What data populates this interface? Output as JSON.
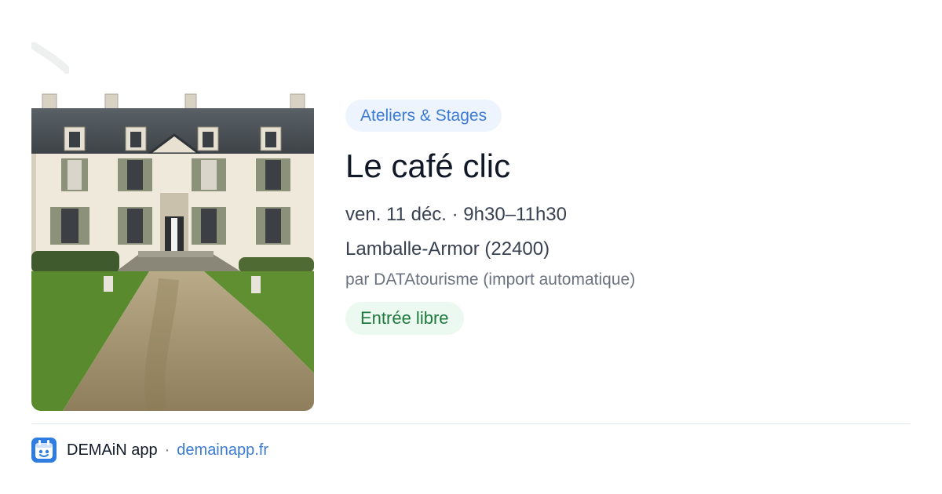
{
  "event": {
    "category": "Ateliers & Stages",
    "title": "Le café clic",
    "date_time": "ven. 11 déc. · 9h30–11h30",
    "location": "Lamballe-Armor (22400)",
    "source": "par DATAtourisme (import automatique)",
    "price": "Entrée libre"
  },
  "footer": {
    "app_name": "DEMAiN app",
    "separator": "·",
    "domain": "demainapp.fr"
  },
  "colors": {
    "category_text": "#3b7bd4",
    "category_bg": "#eef4fe",
    "price_text": "#1e7a3c",
    "price_bg": "#ecf9f0",
    "link": "#3b7bd4",
    "app_icon": "#2f7de1"
  }
}
